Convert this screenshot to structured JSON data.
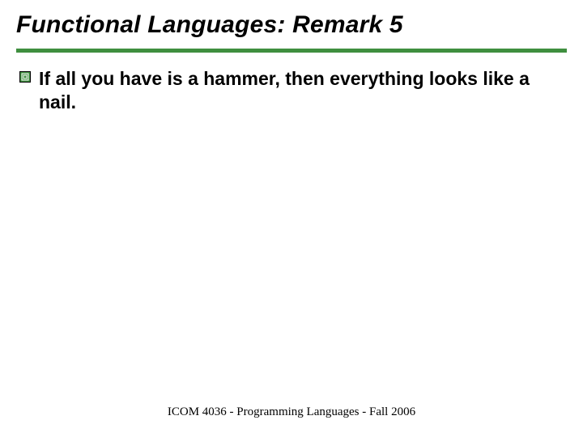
{
  "title": "Functional Languages: Remark 5",
  "bullets": [
    {
      "text": "If all you have is a hammer, then everything looks like a nail."
    }
  ],
  "footer": "ICOM 4036 - Programming Languages - Fall 2006",
  "colors": {
    "accent": "#3f8f3f"
  }
}
